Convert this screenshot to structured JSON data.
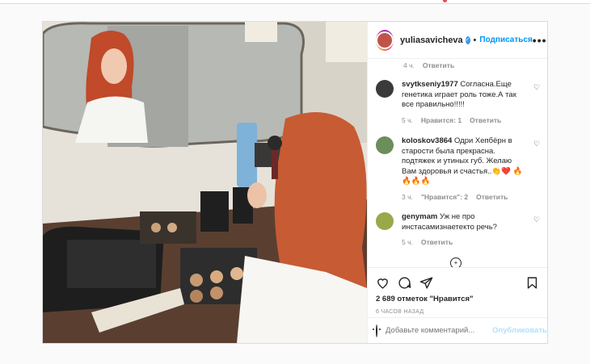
{
  "post": {
    "username": "yuliasavicheva",
    "follow_label": "Подписаться",
    "more_label": "•••",
    "separator": "•"
  },
  "comments": {
    "top_meta": {
      "time": "4 ч.",
      "reply": "Ответить"
    },
    "items": [
      {
        "user": "svytkseniy1977",
        "text": "Согласна.Еще генетика играет роль тоже.А так все правильно!!!!!",
        "time": "5 ч.",
        "likes": "Нравится: 1",
        "reply": "Ответить",
        "avatar_color": "#3a3a3a"
      },
      {
        "user": "koloskov3864",
        "text": "Одри Хепбёрн в старости была прекрасна. подтяжек и утиных губ. Желаю Вам здоровья и счастья..👏❤️ 🔥🔥🔥🔥",
        "time": "3 ч.",
        "likes": "\"Нравится\": 2",
        "reply": "Ответить",
        "avatar_color": "#6b8e5a"
      },
      {
        "user": "genymam",
        "text": "Уж не про инстасамизнаетекто речь?",
        "time": "5 ч.",
        "likes": "",
        "reply": "Ответить",
        "avatar_color": "#9aa84a"
      }
    ],
    "load_more": "+"
  },
  "actions": {
    "likes_text": "2 689 отметок \"Нравится\"",
    "timestamp": "6 ЧАСОВ НАЗАД"
  },
  "add_comment": {
    "placeholder": "Добавьте комментарий...",
    "publish_label": "Опубликовать"
  },
  "colors": {
    "accent": "#0095f6",
    "border": "#dbdbdb",
    "muted": "#8e8e8e"
  }
}
